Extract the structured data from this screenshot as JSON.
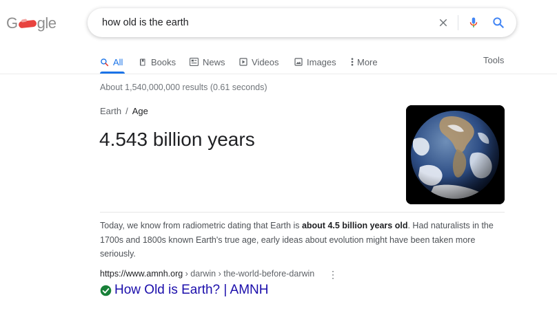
{
  "logo": {
    "text_left": "G",
    "text_right": "gle"
  },
  "search": {
    "query": "how old is the earth"
  },
  "tabs": [
    {
      "label": "All",
      "icon": "search-icon"
    },
    {
      "label": "Books",
      "icon": "book-icon"
    },
    {
      "label": "News",
      "icon": "news-icon"
    },
    {
      "label": "Videos",
      "icon": "video-icon"
    },
    {
      "label": "Images",
      "icon": "image-icon"
    },
    {
      "label": "More",
      "icon": "more-vert-icon"
    }
  ],
  "tools_label": "Tools",
  "result_stats": "About 1,540,000,000 results (0.61 seconds)",
  "knowledge": {
    "breadcrumb_root": "Earth",
    "breadcrumb_sep": "/",
    "breadcrumb_leaf": "Age",
    "answer": "4.543 billion years",
    "image": "earth-globe-photo"
  },
  "snippet": {
    "before": "Today, we know from radiometric dating that Earth is ",
    "bold": "about 4.5 billion years old",
    "after": ". Had naturalists in the 1700s and 1800s known Earth's true age, early ideas about evolution might have been taken more seriously."
  },
  "result": {
    "domain": "https://www.amnh.org",
    "path": " › darwin › the-world-before-darwin",
    "title": "How Old is Earth? | AMNH"
  },
  "colors": {
    "accent_blue": "#1a73e8",
    "link": "#1a0dab",
    "verified_green": "#188038"
  }
}
